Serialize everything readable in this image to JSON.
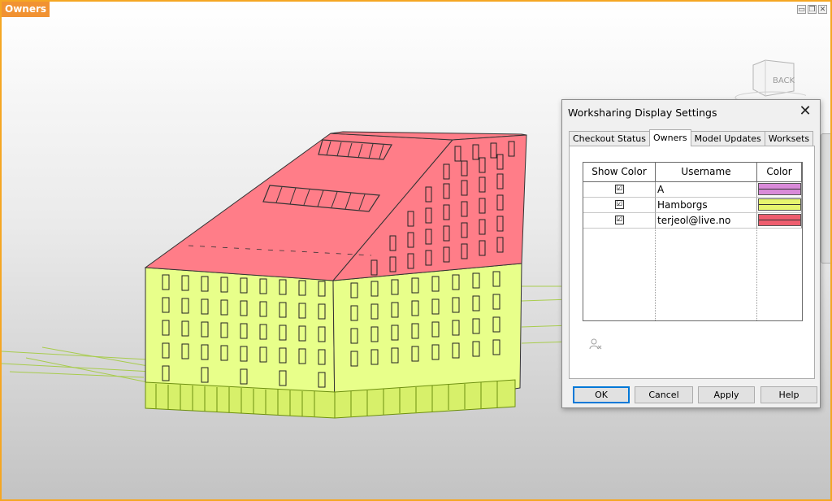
{
  "view": {
    "title": "Owners",
    "controls": [
      "▭",
      "❐",
      "✕"
    ],
    "viewcube_label": "BACK"
  },
  "colors": {
    "roof": "#ff7d88",
    "walls": "#e8ff8a",
    "frame": "#f5a623"
  },
  "dialog": {
    "title": "Worksharing Display Settings",
    "close_label": "✕",
    "tabs": [
      {
        "label": "Checkout Status",
        "active": false
      },
      {
        "label": "Owners",
        "active": true
      },
      {
        "label": "Model Updates",
        "active": false
      },
      {
        "label": "Worksets",
        "active": false
      }
    ],
    "table": {
      "headers": [
        "Show Color",
        "Username",
        "Color"
      ],
      "rows": [
        {
          "checked": "☑",
          "username": "A",
          "color": "#d98ad9"
        },
        {
          "checked": "☑",
          "username": "Hamborgs",
          "color": "#e6f56e"
        },
        {
          "checked": "☑",
          "username": "terjeol@live.no",
          "color": "#ee5d6e"
        }
      ]
    },
    "buttons": {
      "ok": "OK",
      "cancel": "Cancel",
      "apply": "Apply",
      "help": "Help"
    }
  }
}
